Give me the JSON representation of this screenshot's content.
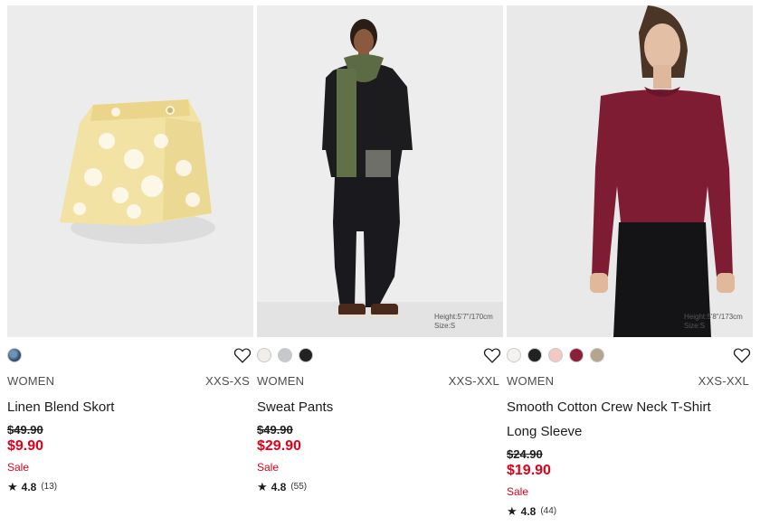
{
  "products": [
    {
      "gender": "WOMEN",
      "size_range": "XXS-XS",
      "name_line1": "Linen Blend Skort",
      "name_line2": "",
      "original_price": "$49.90",
      "sale_price": "$9.90",
      "sale_label": "Sale",
      "rating": "4.8",
      "review_count": "(13)",
      "swatches": [
        "#2f4e70"
      ],
      "model_height": "",
      "model_size": "",
      "image": "yellow-floral-skort"
    },
    {
      "gender": "WOMEN",
      "size_range": "XXS-XXL",
      "name_line1": "Sweat Pants",
      "name_line2": "",
      "original_price": "$49.90",
      "sale_price": "$29.90",
      "sale_label": "Sale",
      "rating": "4.8",
      "review_count": "(55)",
      "swatches": [
        "#f1eeea",
        "#c7c8cc",
        "#222222"
      ],
      "model_height": "Height:5'7\"/170cm",
      "model_size": "Size:S",
      "image": "model-black-sweatpants-green-scarf"
    },
    {
      "gender": "WOMEN",
      "size_range": "XXS-XXL",
      "name_line1": "Smooth Cotton Crew Neck T-Shirt",
      "name_line2": "Long Sleeve",
      "original_price": "$24.90",
      "sale_price": "$19.90",
      "sale_label": "Sale",
      "rating": "4.8",
      "review_count": "(44)",
      "swatches": [
        "#f4f1ee",
        "#222222",
        "#f2c9c4",
        "#8a1f38",
        "#b5a58f"
      ],
      "model_height": "Height:5'8\"/173cm",
      "model_size": "Size:S",
      "image": "model-burgundy-long-sleeve-tee"
    }
  ],
  "colors": {
    "sale_red": "#e0001b",
    "text": "#1b1b1b",
    "photo_bg": "#ececec"
  },
  "icons": {
    "favorite": "heart-outline-icon",
    "rating": "star-icon"
  }
}
